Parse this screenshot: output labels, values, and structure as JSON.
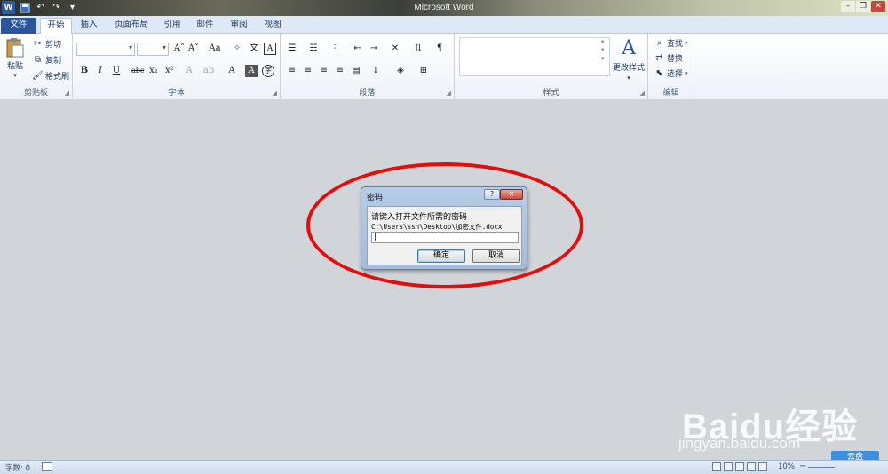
{
  "app": {
    "title": "Microsoft Word"
  },
  "qat": {
    "logo": "W",
    "icons": [
      "word-logo-icon",
      "save-icon",
      "undo-icon",
      "redo-icon",
      "customize-icon"
    ]
  },
  "tabs": [
    {
      "label": "文件",
      "type": "file"
    },
    {
      "label": "开始",
      "type": "active"
    },
    {
      "label": "插入"
    },
    {
      "label": "页面布局"
    },
    {
      "label": "引用"
    },
    {
      "label": "邮件"
    },
    {
      "label": "审阅"
    },
    {
      "label": "视图"
    }
  ],
  "ribbon": {
    "clipboard": {
      "label": "剪贴板",
      "paste": "粘贴",
      "cut": "剪切",
      "copy": "复制",
      "format_painter": "格式刷"
    },
    "font": {
      "label": "字体",
      "font_name": "",
      "font_size": ""
    },
    "paragraph": {
      "label": "段落"
    },
    "styles": {
      "label": "样式",
      "change_styles": "更改样式"
    },
    "editing": {
      "label": "编辑",
      "find": "查找",
      "replace": "替换",
      "select": "选择"
    }
  },
  "dialog": {
    "title": "密码",
    "help": "?",
    "close": "✕",
    "prompt": "请键入打开文件所需的密码",
    "path": "C:\\Users\\ssh\\Desktop\\加密文件.docx",
    "input_value": "",
    "ok_label": "确定",
    "cancel_label": "取消"
  },
  "status": {
    "word_count": "字数: 0",
    "zoom": "10%"
  },
  "watermark": {
    "logo": "Baidu经验",
    "sub": "jingyan.baidu.com",
    "badge": "云盘"
  },
  "colors": {
    "file_tab": "#2b579a",
    "highlight_ellipse": "#e20d0d",
    "workspace": "#d1d4d9"
  }
}
